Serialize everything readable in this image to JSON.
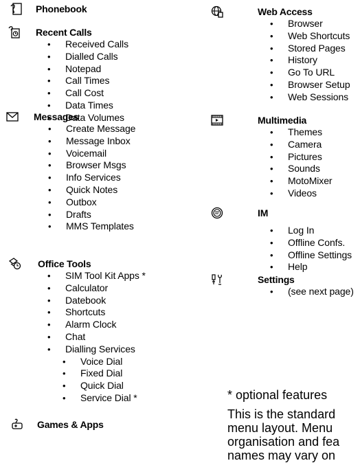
{
  "left": [
    {
      "id": "phonebook",
      "title": "Phonebook",
      "icon": "phonebook-icon",
      "items": []
    },
    {
      "id": "recent-calls",
      "title": "Recent Calls",
      "icon": "recent-calls-icon",
      "items": [
        "Received Calls",
        "Dialled Calls",
        "Notepad",
        "Call Times",
        "Call Cost",
        "Data Times",
        "Data Volumes"
      ]
    },
    {
      "id": "messages",
      "title": "Messages",
      "icon": "envelope-icon",
      "items": [
        "Create Message",
        "Message Inbox",
        "Voicemail",
        "Browser Msgs",
        "Info Services",
        "Quick Notes",
        "Outbox",
        "Drafts",
        "MMS Templates"
      ]
    },
    {
      "id": "office-tools",
      "title": "Office Tools",
      "icon": "office-tools-icon",
      "items": [
        "SIM Tool Kit Apps *",
        "Calculator",
        "Datebook",
        "Shortcuts",
        "Alarm Clock",
        "Chat",
        "Dialling Services"
      ],
      "subitems": [
        "Voice Dial",
        "Fixed Dial",
        "Quick Dial",
        "Service Dial *"
      ]
    },
    {
      "id": "games-apps",
      "title": "Games & Apps",
      "icon": "games-apps-icon",
      "items": []
    }
  ],
  "right": [
    {
      "id": "web-access",
      "title": "Web Access",
      "icon": "globe-icon",
      "items": [
        "Browser",
        "Web Shortcuts",
        "Stored Pages",
        "History",
        "Go To URL",
        "Browser Setup",
        "Web Sessions"
      ]
    },
    {
      "id": "multimedia",
      "title": "Multimedia",
      "icon": "film-icon",
      "items": [
        "Themes",
        "Camera",
        "Pictures",
        "Sounds",
        "MotoMixer",
        "Videos"
      ]
    },
    {
      "id": "im",
      "title": "IM",
      "icon": "im-icon",
      "items": [
        "Log In",
        "Offline Confs.",
        "Offline Settings",
        "Help"
      ]
    },
    {
      "id": "settings",
      "title": "Settings",
      "icon": "settings-icon",
      "items": [
        "(see next page)"
      ]
    }
  ],
  "footnote": "* optional features",
  "note_lines": [
    "This is the standard",
    "menu layout. Menu",
    "organisation and fea",
    "names may vary on"
  ]
}
